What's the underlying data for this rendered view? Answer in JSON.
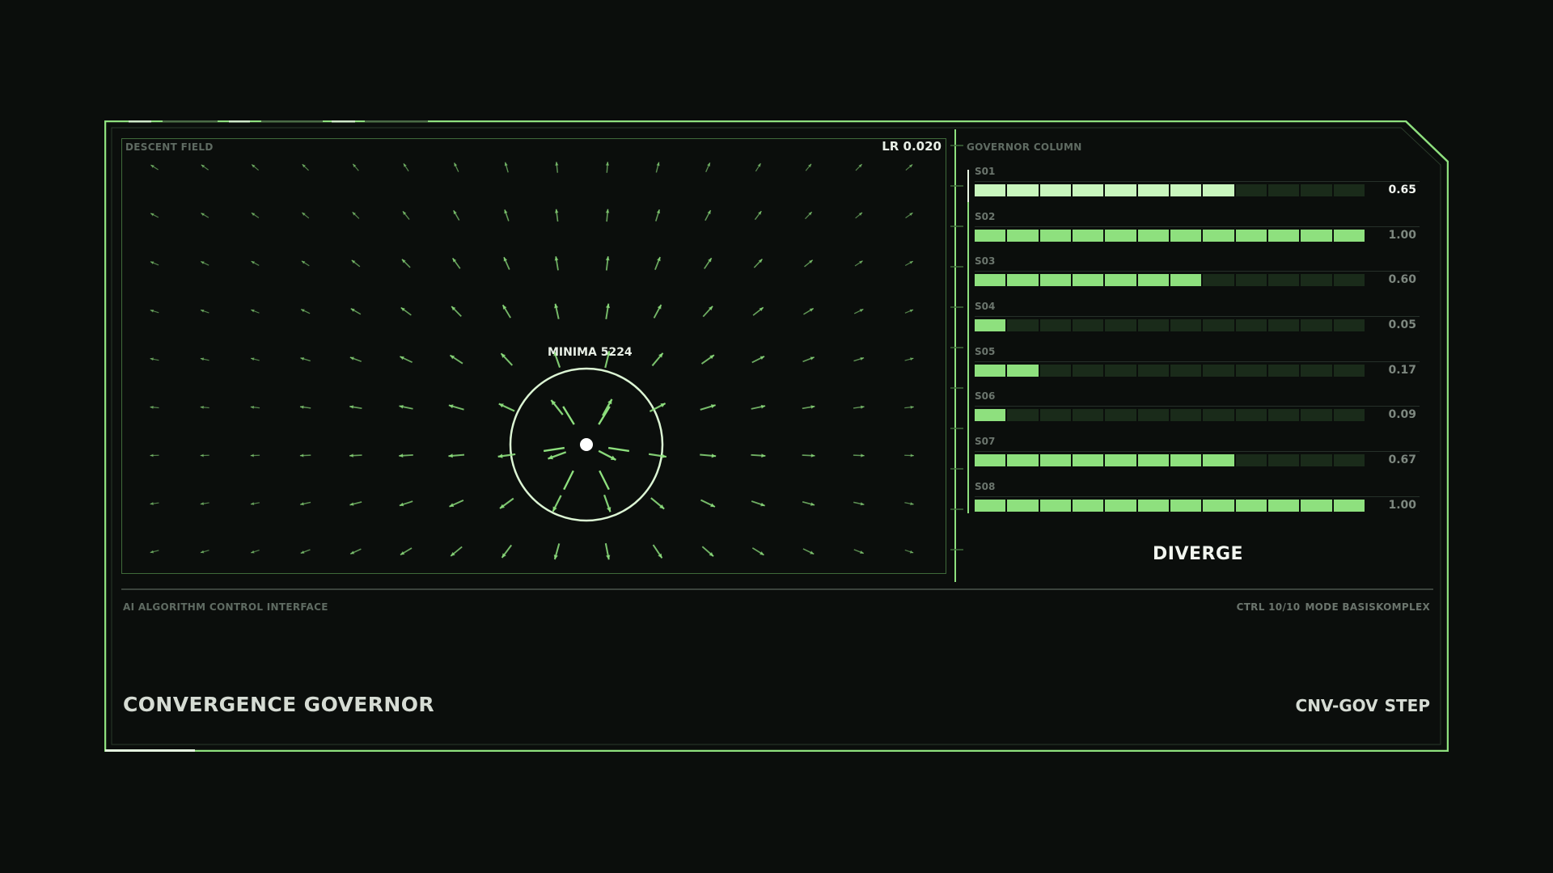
{
  "colors": {
    "background": "#0b0e0c",
    "accent": "#8ee07e",
    "accent_light": "#c8f5bd",
    "frame": "#8ee07e",
    "text_primary": "#e8efe6",
    "text_muted": "#6b756d"
  },
  "descent_field": {
    "title": "DESCENT FIELD",
    "learning_rate": "LR 0.020",
    "minima_label": "MINIMA 5224"
  },
  "governor": {
    "title": "GOVERNOR COLUMN",
    "segments_per_bar": 12,
    "rows": [
      {
        "label": "S01",
        "value": "0.65",
        "level": 0.65,
        "highlighted": true
      },
      {
        "label": "S02",
        "value": "1.00",
        "level": 1.0,
        "highlighted": false
      },
      {
        "label": "S03",
        "value": "0.60",
        "level": 0.6,
        "highlighted": false
      },
      {
        "label": "S04",
        "value": "0.05",
        "level": 0.05,
        "highlighted": false
      },
      {
        "label": "S05",
        "value": "0.17",
        "level": 0.17,
        "highlighted": false
      },
      {
        "label": "S06",
        "value": "0.09",
        "level": 0.09,
        "highlighted": false
      },
      {
        "label": "S07",
        "value": "0.67",
        "level": 0.67,
        "highlighted": false
      },
      {
        "label": "S08",
        "value": "1.00",
        "level": 1.0,
        "highlighted": false
      }
    ],
    "mode_state": "DIVERGE"
  },
  "footer": {
    "interface_label": "AI ALGORITHM CONTROL INTERFACE",
    "ctrl": "CTRL 10/10",
    "mode": "MODE BASISKOMPLEX",
    "title": "CONVERGENCE GOVERNOR",
    "code": "CNV-GOV",
    "action": "STEP"
  }
}
